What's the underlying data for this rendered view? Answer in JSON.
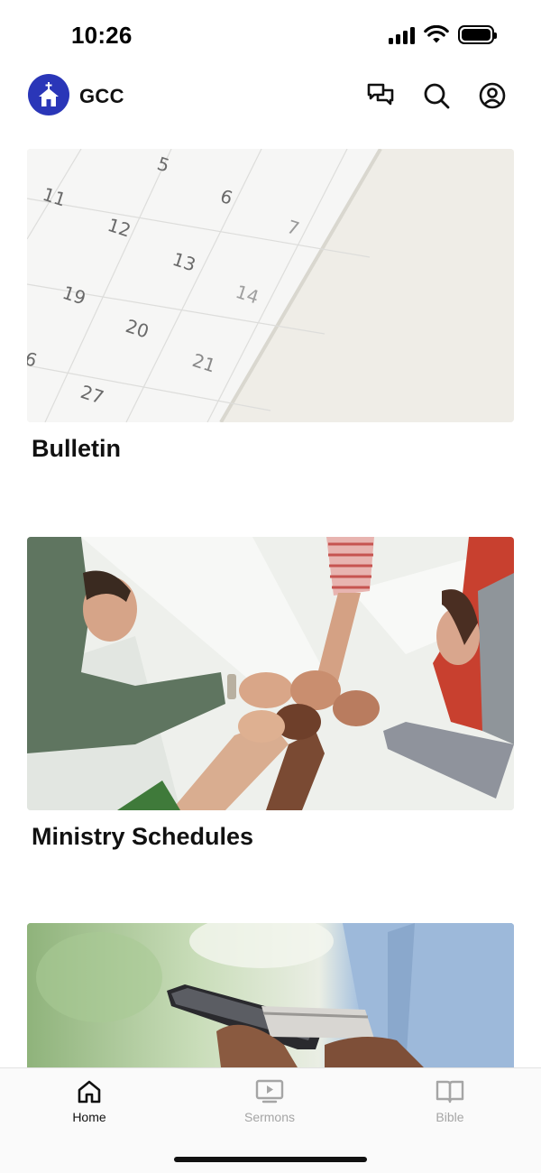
{
  "status_bar": {
    "time": "10:26"
  },
  "header": {
    "title": "GCC",
    "brand_color": "#2a36b8"
  },
  "feed": {
    "cards": [
      {
        "title": "Bulletin"
      },
      {
        "title": "Ministry Schedules"
      },
      {
        "title": ""
      }
    ],
    "calendar_numbers": [
      "5",
      "6",
      "7",
      "11",
      "12",
      "13",
      "14",
      "19",
      "20",
      "21",
      "27",
      "6"
    ]
  },
  "tab_bar": {
    "tabs": [
      {
        "label": "Home",
        "icon": "home-icon",
        "active": true
      },
      {
        "label": "Sermons",
        "icon": "video-icon",
        "active": false
      },
      {
        "label": "Bible",
        "icon": "book-icon",
        "active": false
      }
    ]
  }
}
